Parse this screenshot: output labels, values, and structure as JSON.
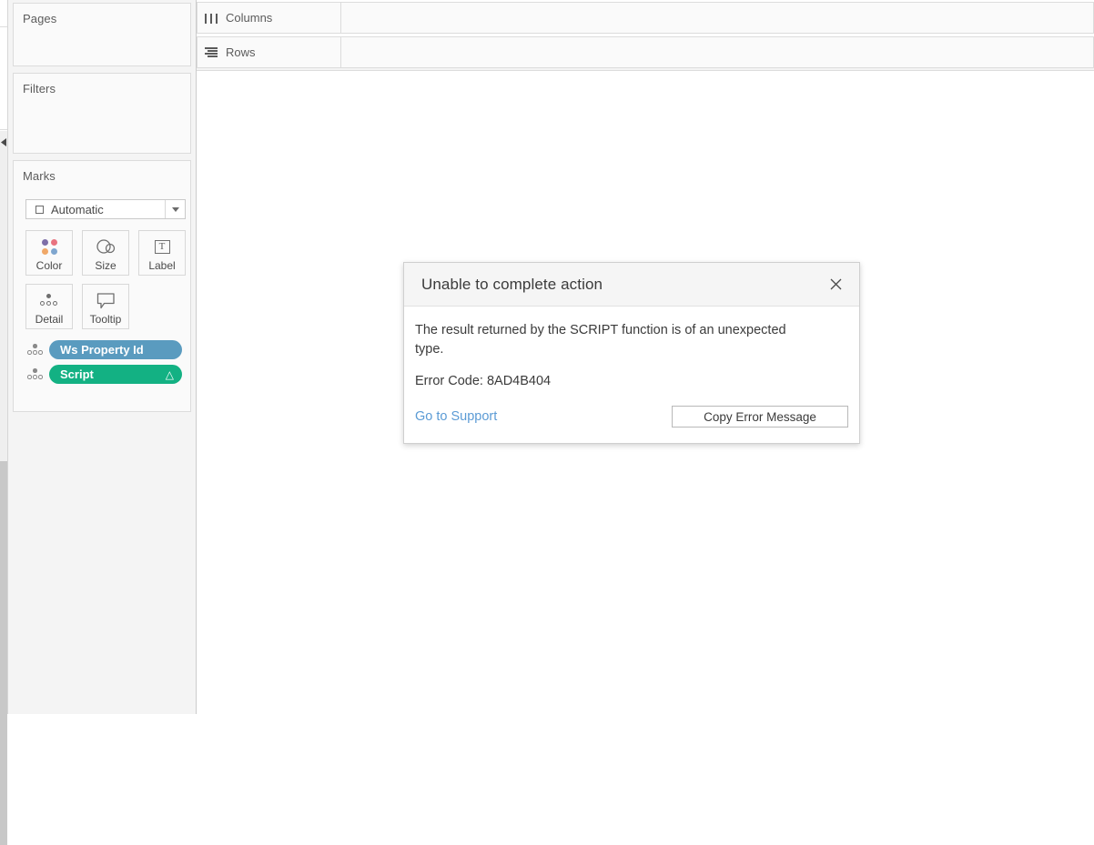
{
  "app": {
    "name": "Tableau Desktop Worksheet"
  },
  "left_pane": {
    "collapse_arrow_icon": "triangle-left-icon",
    "scrollbar": "vertical-scrollbar"
  },
  "shelves": {
    "pages": {
      "title": "Pages"
    },
    "filters": {
      "title": "Filters"
    },
    "marks": {
      "title": "Marks",
      "mark_type": {
        "label": "Automatic",
        "icon": "square-icon",
        "caret_icon": "chevron-down-icon"
      },
      "buttons": [
        {
          "label": "Color",
          "icon": "color-dots-icon"
        },
        {
          "label": "Size",
          "icon": "size-circles-icon"
        },
        {
          "label": "Label",
          "icon": "text-label-icon"
        },
        {
          "label": "Detail",
          "icon": "detail-dots-icon"
        },
        {
          "label": "Tooltip",
          "icon": "tooltip-bubble-icon"
        }
      ],
      "colors": {
        "color_dot_1": "#7e6fa8",
        "color_dot_2": "#e8737f",
        "color_dot_3": "#f0a868",
        "color_dot_4": "#7fa6cf"
      },
      "pills": [
        {
          "label": "Ws Property Id",
          "color": "#5a9bbf",
          "handle_icon": "detail-dots-icon",
          "indicator": ""
        },
        {
          "label": "Script",
          "color": "#13b183",
          "handle_icon": "detail-dots-icon",
          "indicator": "△"
        }
      ]
    }
  },
  "shelf_bars": {
    "columns": {
      "label": "Columns",
      "icon": "columns-icon",
      "value": ""
    },
    "rows": {
      "label": "Rows",
      "icon": "rows-icon",
      "value": ""
    }
  },
  "dialog": {
    "title": "Unable to complete action",
    "close_icon": "close-icon",
    "message": "The result returned by the SCRIPT function is of an unexpected type.",
    "error_code": "Error Code: 8AD4B404",
    "support_link": "Go to Support",
    "copy_button": "Copy Error Message",
    "link_color": "#5b9bd5"
  }
}
